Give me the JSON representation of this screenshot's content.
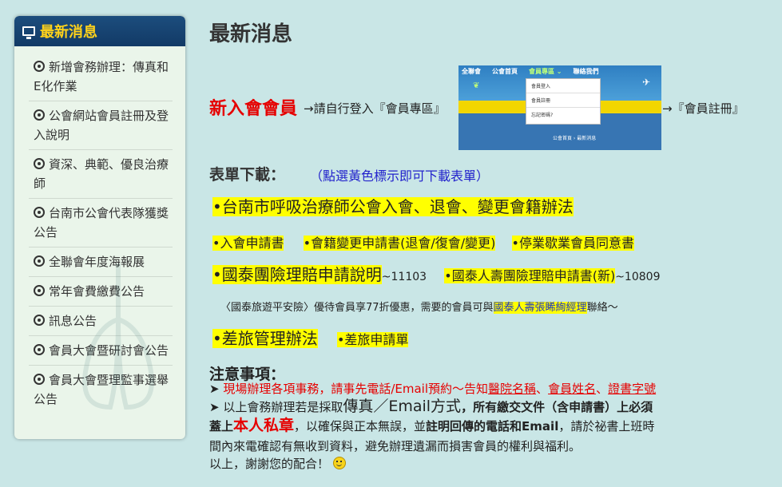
{
  "sidebar": {
    "title": "最新消息",
    "items": [
      {
        "label": "新增會務辦理：傳真和E化作業"
      },
      {
        "label": "公會網站會員註冊及登入說明"
      },
      {
        "label": "資深、典範、優良治療師"
      },
      {
        "label": "台南市公會代表隊獲獎公告"
      },
      {
        "label": "全聯會年度海報展"
      },
      {
        "label": "常年會費繳費公告"
      },
      {
        "label": "訊息公告"
      },
      {
        "label": "會員大會暨研討會公告"
      },
      {
        "label": "會員大會暨理監事選舉公告"
      }
    ]
  },
  "main": {
    "title": "最新消息",
    "new_member": {
      "label": "新入會會員",
      "step1": "→請自行登入『會員專區』",
      "step2": "→『會員註冊』"
    },
    "site_shot": {
      "nav": [
        "全聯會",
        "公會首頁",
        "會員專區 ⌄",
        "聯絡我們"
      ],
      "dropdown": [
        "會員登入",
        "會員註冊",
        "忘記密碼?"
      ],
      "breadcrumb": "公會首頁 › 最新消息"
    },
    "forms": {
      "label": "表單下載：",
      "note": "（點選黃色標示即可下載表單）",
      "rules": "•台南市呼吸治療師公會入會、退會、變更會籍辦法",
      "apply": "•入會申請書",
      "change": "•會籍變更申請書(退會/復會/變更)",
      "suspend": "•停業歇業會員同意書",
      "insurance_guide": "•國泰團險理賠申請說明",
      "insurance_guide_ver": "~11103",
      "insurance_form": "•國泰人壽團險理賠申請書(新)",
      "insurance_form_ver": "~10809",
      "travel_pre": "〈國泰旅遊平安險〉優待會員享77折優惠，需要的會員可與",
      "travel_contact": "國泰人壽張睎絢經理",
      "travel_post": "聯絡～",
      "trip_rules": "•差旅管理辦法",
      "trip_form": "•差旅申請單"
    },
    "notice": {
      "title": "注意事項：",
      "line1_prefix": "➤ ",
      "line1_text": "現場辦理各項事務，請事先電話/Email預約～告知",
      "line1_hospital": "醫院名稱",
      "sep1": "、",
      "line1_name": "會員姓名",
      "sep2": "、",
      "line1_cert": "證書字號",
      "line2_a": "➤ 以上會務辦理若是採取",
      "line2_b": "傳真／Email方式",
      "line2_c": "，所有繳交文件（含申請書）上必須",
      "line3_a": "蓋上",
      "line3_b": "本人私章",
      "line3_c": "，以確保與正本無誤，並",
      "line3_d": "註明回傳的電話和Email",
      "line3_e": "，請於祕書上班時",
      "line4": "間內來電確認有無收到資料，避免辦理遺漏而損害會員的權利與福利。",
      "line5": "以上，謝謝您的配合！"
    }
  }
}
